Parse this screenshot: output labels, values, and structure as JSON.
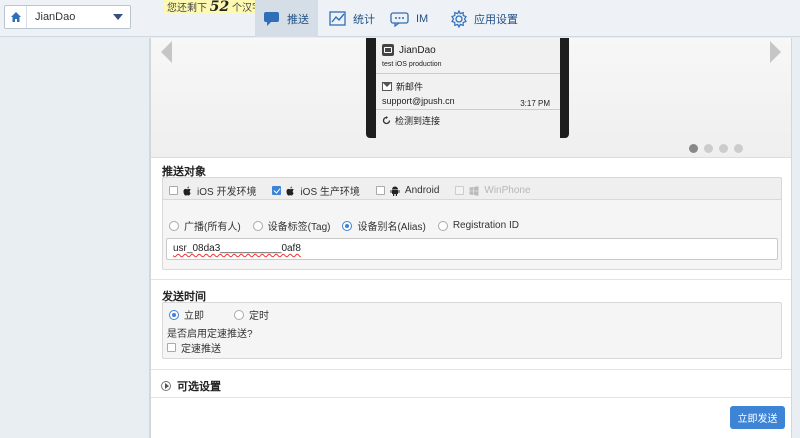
{
  "header": {
    "app_select": {
      "value": "JianDao"
    },
    "hint": {
      "prefix": "您还剩下",
      "count": "52",
      "suffix": "个汉字可以输入"
    },
    "nav": [
      {
        "label": "推送",
        "icon": "push-icon",
        "active": true
      },
      {
        "label": "统计",
        "icon": "chart-icon",
        "active": false
      },
      {
        "label": "IM",
        "icon": "chat-icon",
        "active": false
      },
      {
        "label": "应用设置",
        "icon": "gear-icon",
        "active": false
      }
    ]
  },
  "preview": {
    "notification": {
      "app": "JianDao",
      "text": "test iOS production",
      "mail_title": "新邮件",
      "mail_from": "support@jpush.cn",
      "mail_time": "3:17 PM",
      "next_item": "检测到连接"
    },
    "dots": 4,
    "active_dot": 0
  },
  "target": {
    "label": "推送对象",
    "platforms": [
      {
        "label": "iOS 开发环境",
        "checked": false,
        "disabled": false
      },
      {
        "label": "iOS 生产环境",
        "checked": true,
        "disabled": false
      },
      {
        "label": "Android",
        "checked": false,
        "disabled": false
      },
      {
        "label": "WinPhone",
        "checked": false,
        "disabled": true
      }
    ],
    "audience": [
      {
        "label": "广播(所有人)",
        "selected": false
      },
      {
        "label": "设备标签(Tag)",
        "selected": false
      },
      {
        "label": "设备别名(Alias)",
        "selected": true
      },
      {
        "label": "Registration ID",
        "selected": false
      }
    ],
    "alias_value": "usr_08da3___________0af8"
  },
  "send_time": {
    "label": "发送时间",
    "options": [
      {
        "label": "立即",
        "selected": true
      },
      {
        "label": "定时",
        "selected": false
      }
    ],
    "rate_question": "是否启用定速推送?",
    "rate_label": "定速推送",
    "rate_checked": false
  },
  "optional": {
    "label": "可选设置"
  },
  "actions": {
    "send_label": "立即发送"
  },
  "colors": {
    "accent": "#3d84d6",
    "nav_text": "#1f4f86",
    "hint_bg": "#fdf9b0"
  }
}
